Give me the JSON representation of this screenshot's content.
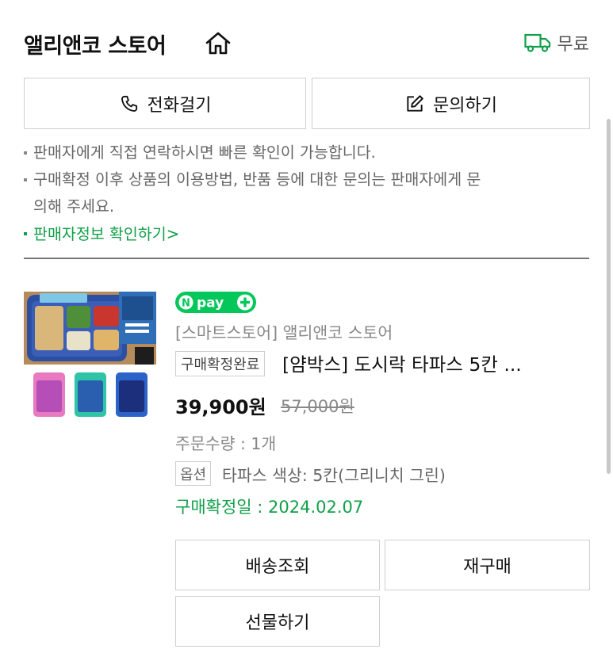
{
  "store": {
    "name": "앨리앤코 스토어",
    "shipping_label": "무료"
  },
  "actions": {
    "call_label": "전화걸기",
    "inquiry_label": "문의하기"
  },
  "notes": {
    "line1": "판매자에게 직접 연락하시면 빠른 확인이 가능합니다.",
    "line2a": "구매확정 이후 상품의 이용방법, 반품 등에 대한 문의는 판매자에게 문",
    "line2b": "의해 주세요.",
    "seller_info_link": "판매자정보 확인하기"
  },
  "product": {
    "badge": "N pay +",
    "seller": "[스마트스토어] 앨리앤코 스토어",
    "status": "구매확정완료",
    "title": "[얌박스] 도시락 타파스 5칸 ...",
    "price": "39,900원",
    "original_price": "57,000원",
    "quantity": "주문수량 : 1개",
    "option_label": "옵션",
    "option_value": "타파스 색상: 5칸(그리니치 그린)",
    "confirm_date": "구매확정일 : 2024.02.07"
  },
  "order_buttons": {
    "track": "배송조회",
    "rebuy": "재구매",
    "gift": "선물하기"
  },
  "colors": {
    "accent_green": "#11a04a",
    "npay_green": "#03c75a"
  }
}
